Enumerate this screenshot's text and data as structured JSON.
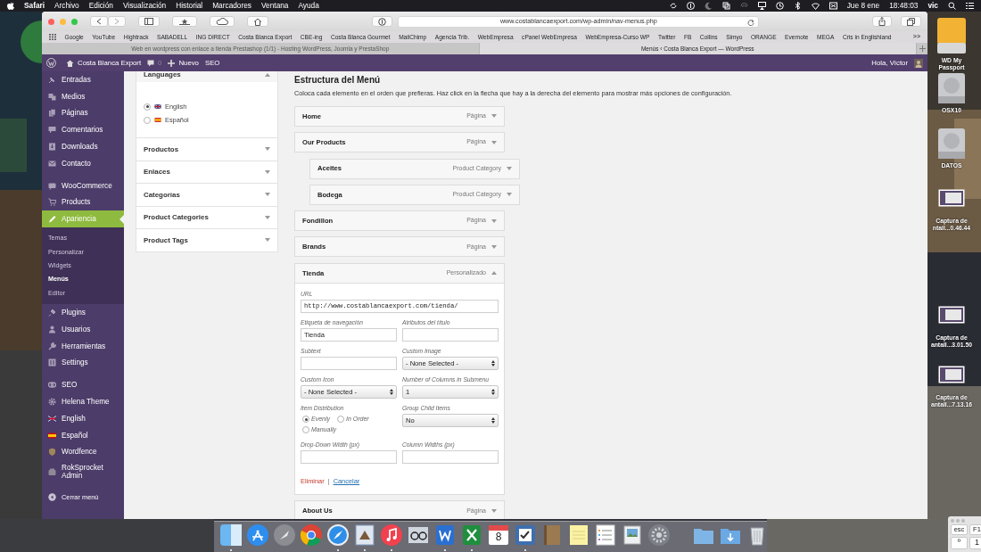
{
  "menubar": {
    "app": "Safari",
    "menus": [
      "Archivo",
      "Edición",
      "Visualización",
      "Historial",
      "Marcadores",
      "Ventana",
      "Ayuda"
    ],
    "date": "Jue 8 ene",
    "time": "18:48:03",
    "user": "vic"
  },
  "browser": {
    "address": "www.costablancaexport.com/wp-admin/nav-menus.php",
    "bookmarks": [
      "Google",
      "YouTube",
      "Hightrack",
      "SABADELL",
      "ING DIRECT",
      "Costa Blanca Export",
      "CBE-ing",
      "Costa Blanca Gourmet",
      "MailChimp",
      "Agencia Trib.",
      "WebEmpresa",
      "cPanel WebEmpresa",
      "WebEmpresa-Curso WP",
      "Twitter",
      "FB",
      "Collins",
      "Simyo",
      "ORANGE",
      "Evernote",
      "MEGA",
      "Cris in Englishland"
    ],
    "more": ">>",
    "tabs": [
      {
        "title": "Web en wordpress con enlace a tienda Prestashop (1/1) - Hosting WordPress, Joomla y PrestaShop",
        "selected": false
      },
      {
        "title": "Menús ‹ Costa Blanca Export — WordPress",
        "selected": true
      }
    ]
  },
  "admin_bar": {
    "site": "Costa Blanca Export",
    "comments": "0",
    "new": "Nuevo",
    "seo": "SEO",
    "greeting": "Hola, Víctor"
  },
  "sidebar": {
    "groups": [
      {
        "items": [
          {
            "label": "Entradas",
            "kind": "pin",
            "selected": false
          },
          {
            "label": "Medios",
            "kind": "media",
            "selected": false
          },
          {
            "label": "Páginas",
            "kind": "page",
            "selected": false
          },
          {
            "label": "Comentarios",
            "kind": "comment",
            "selected": false
          },
          {
            "label": "Downloads",
            "kind": "download",
            "selected": false
          },
          {
            "label": "Contacto",
            "kind": "mail",
            "selected": false
          }
        ]
      },
      {
        "items": [
          {
            "label": "WooCommerce",
            "kind": "woo",
            "selected": false
          },
          {
            "label": "Products",
            "kind": "cart",
            "selected": false
          },
          {
            "label": "Apariencia",
            "kind": "brush",
            "selected": true,
            "children": [
              {
                "label": "Temas",
                "selected": false
              },
              {
                "label": "Personalizar",
                "selected": false
              },
              {
                "label": "Widgets",
                "selected": false
              },
              {
                "label": "Menús",
                "selected": true
              },
              {
                "label": "Editor",
                "selected": false
              }
            ]
          },
          {
            "label": "Plugins",
            "kind": "plug",
            "selected": false
          },
          {
            "label": "Usuarios",
            "kind": "user",
            "selected": false
          },
          {
            "label": "Herramientas",
            "kind": "wrench",
            "selected": false
          },
          {
            "label": "Settings",
            "kind": "settings",
            "selected": false
          }
        ]
      },
      {
        "items": [
          {
            "label": "SEO",
            "kind": "seo",
            "selected": false
          },
          {
            "label": "Helena Theme",
            "kind": "gear",
            "selected": false
          },
          {
            "label": "English",
            "kind": "flag-uk",
            "selected": false
          },
          {
            "label": "Español",
            "kind": "flag-es",
            "selected": false
          },
          {
            "label": "Wordfence",
            "kind": "shield",
            "selected": false
          },
          {
            "label": "RokSprocket Admin",
            "kind": "box",
            "selected": false
          }
        ]
      }
    ],
    "collapse": "Cerrar menú"
  },
  "accordion": [
    {
      "title": "Languages",
      "expanded": true,
      "options": [
        {
          "label": "English",
          "kind": "flag-uk",
          "selected": true
        },
        {
          "label": "Español",
          "kind": "flag-es",
          "selected": false
        }
      ]
    },
    {
      "title": "Productos",
      "expanded": false
    },
    {
      "title": "Enlaces",
      "expanded": false
    },
    {
      "title": "Categorías",
      "expanded": false
    },
    {
      "title": "Product Categories",
      "expanded": false
    },
    {
      "title": "Product Tags",
      "expanded": false
    }
  ],
  "menu_structure": {
    "title": "Estructura del Menú",
    "description": "Coloca cada elemento en el orden que prefieras. Haz click en la flecha que hay a la derecha del elemento para mostrar más opciones de configuración.",
    "items": [
      {
        "title": "Home",
        "type": "Página",
        "expanded": false
      },
      {
        "title": "Our Products",
        "type": "Página",
        "expanded": false,
        "children": [
          {
            "title": "Aceites",
            "type": "Product Category",
            "expanded": false
          },
          {
            "title": "Bodega",
            "type": "Product Category",
            "expanded": false
          }
        ]
      },
      {
        "title": "Fondillon",
        "type": "Página",
        "expanded": false
      },
      {
        "title": "Brands",
        "type": "Página",
        "expanded": false
      },
      {
        "title": "Tienda",
        "type": "Personalizado",
        "expanded": true,
        "settings": {
          "url_label": "URL",
          "url": "http://www.costablancaexport.com/tienda/",
          "fields": [
            {
              "kind": "text",
              "label": "Etiqueta de navegación",
              "value": "Tienda"
            },
            {
              "kind": "text",
              "label": "Atributos del título"
            },
            {
              "kind": "text",
              "label": "Subtext"
            },
            {
              "kind": "select",
              "label": "Custom Image",
              "value": "- None Selected -"
            },
            {
              "kind": "select",
              "label": "Custom Icon",
              "value": "- None Selected -"
            },
            {
              "kind": "select",
              "label": "Number of Columns in Submenu",
              "value": "1"
            },
            {
              "kind": "radio",
              "label": "Item Distribution",
              "options": [
                {
                  "label": "Evenly",
                  "selected": true
                },
                {
                  "label": "In Order",
                  "selected": false
                },
                {
                  "label": "Manually",
                  "selected": false
                }
              ]
            },
            {
              "kind": "select",
              "label": "Group Child Items",
              "value": "No"
            },
            {
              "kind": "text",
              "label": "Drop-Down Width (px)"
            },
            {
              "kind": "text",
              "label": "Column Widths (px)"
            }
          ],
          "remove": "Eliminar",
          "separator": "|",
          "cancel": "Cancelar"
        }
      },
      {
        "title": "About Us",
        "type": "Página",
        "expanded": false
      }
    ]
  },
  "desktop_icons": [
    {
      "kind": "drive-external",
      "label_lines": [
        "WD My",
        "Passport"
      ]
    },
    {
      "kind": "drive",
      "label_lines": [
        "OSX10"
      ]
    },
    {
      "kind": "drive",
      "label_lines": [
        "DATOS"
      ]
    },
    {
      "kind": "screenshot",
      "label_lines": [
        "Captura de",
        "ntall...0.46.44"
      ]
    },
    {
      "kind": "screenshot",
      "label_lines": [
        "Captura de",
        "antall...3.01.50"
      ]
    },
    {
      "kind": "screenshot",
      "label_lines": [
        "Captura de",
        "antall...7.13.16"
      ]
    }
  ],
  "dock": {
    "apps": [
      {
        "kind": "finder",
        "running": true
      },
      {
        "kind": "appstore",
        "running": false
      },
      {
        "kind": "rocket",
        "running": false
      },
      {
        "kind": "browser",
        "running": false
      },
      {
        "kind": "compass",
        "running": true
      },
      {
        "kind": "stamp",
        "running": true
      },
      {
        "kind": "music",
        "running": true
      },
      {
        "kind": "glasses",
        "running": false
      },
      {
        "kind": "document",
        "running": true
      },
      {
        "kind": "spreadsheet",
        "running": true
      },
      {
        "kind": "calendar",
        "day": "8",
        "running": false
      },
      {
        "kind": "checkbox",
        "running": true
      },
      {
        "kind": "notebook",
        "running": false
      },
      {
        "kind": "note",
        "running": false
      },
      {
        "kind": "list",
        "running": false
      },
      {
        "kind": "photos",
        "running": false
      },
      {
        "kind": "gear",
        "running": false
      }
    ],
    "stacks": [
      {
        "kind": "folder",
        "running": false
      },
      {
        "kind": "download-folder",
        "running": false
      },
      {
        "kind": "trash",
        "running": false
      }
    ]
  },
  "keyboard_viewer": {
    "keys": [
      "esc",
      "F1",
      "º",
      "1"
    ]
  }
}
